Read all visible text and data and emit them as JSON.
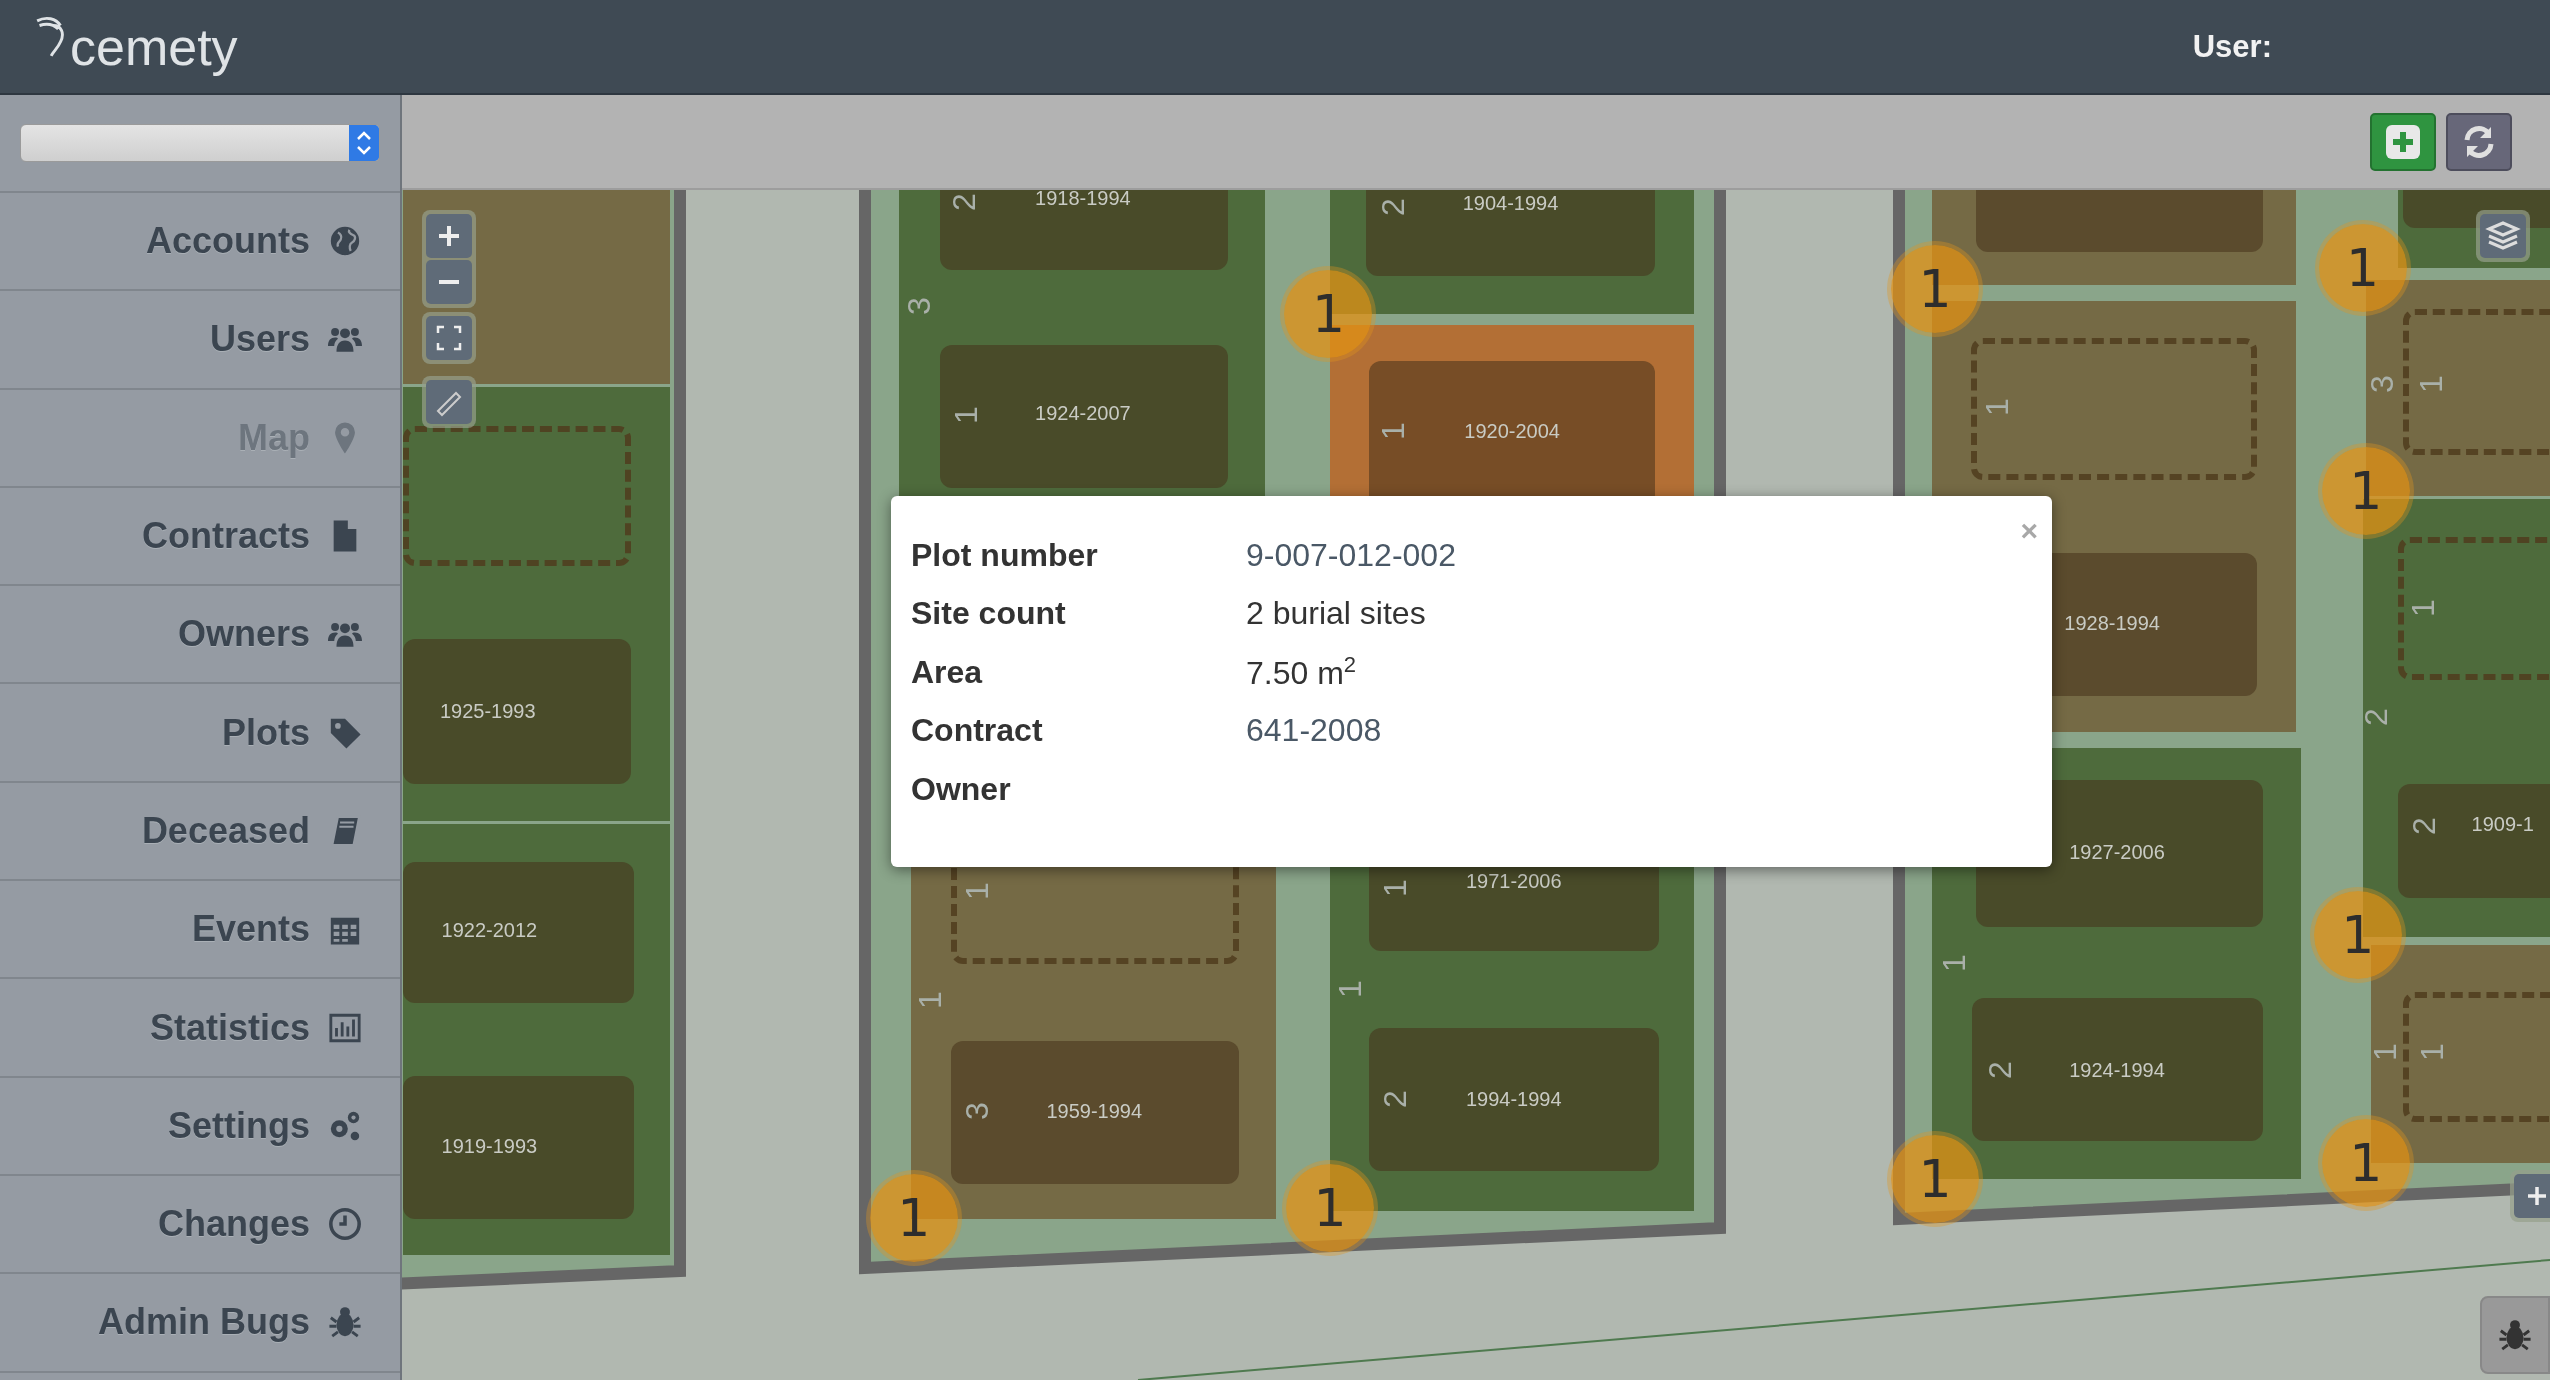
{
  "header": {
    "logo": "cemety",
    "user_label": "User:"
  },
  "sidebar": {
    "items": [
      {
        "label": "Accounts",
        "selected": false
      },
      {
        "label": "Users",
        "selected": false
      },
      {
        "label": "Map",
        "selected": true
      },
      {
        "label": "Contracts",
        "selected": false
      },
      {
        "label": "Owners",
        "selected": false
      },
      {
        "label": "Plots",
        "selected": false
      },
      {
        "label": "Deceased",
        "selected": false
      },
      {
        "label": "Events",
        "selected": false
      },
      {
        "label": "Statistics",
        "selected": false
      },
      {
        "label": "Settings",
        "selected": false
      },
      {
        "label": "Changes",
        "selected": false
      },
      {
        "label": "Admin Bugs",
        "selected": false
      }
    ]
  },
  "map": {
    "plots": [
      {
        "color": "#756a45"
      },
      {
        "color": "#4e6b3c"
      },
      {
        "color": "#4e6b3c"
      },
      {
        "color": "#4e6b3c"
      },
      {
        "color": "#756a45"
      },
      {
        "color": "#4e6b3c"
      },
      {
        "color": "#b36f35"
      },
      {
        "color": "#4e6b3c"
      },
      {
        "color": "#756a45"
      },
      {
        "color": "#756a45"
      },
      {
        "color": "#4e6b3c"
      },
      {
        "color": "#4e6b3c"
      },
      {
        "color": "#756a45"
      },
      {
        "color": "#4e6b3c"
      },
      {
        "color": "#756a45"
      }
    ],
    "graves": [
      {
        "kind": "empty"
      },
      {
        "kind": "occupied",
        "years": "1925-1993"
      },
      {
        "kind": "occupied",
        "years": "1922-2012"
      },
      {
        "kind": "occupied",
        "years": "1919-1993"
      },
      {
        "kind": "occupied",
        "years": "1918-1994"
      },
      {
        "kind": "occupied",
        "years": "1924-2007"
      },
      {
        "kind": "empty"
      },
      {
        "kind": "occupied",
        "years": "1959-1994"
      },
      {
        "kind": "occupied",
        "years": "1904-1994"
      },
      {
        "kind": "occupied",
        "years": "1920-2004"
      },
      {
        "kind": "occupied",
        "years": "1971-2006"
      },
      {
        "kind": "occupied",
        "years": "1994-1994"
      },
      {
        "kind": "occupied"
      },
      {
        "kind": "empty"
      },
      {
        "kind": "occupied",
        "years": "1928-1994"
      },
      {
        "kind": "occupied",
        "years": "1927-2006"
      },
      {
        "kind": "occupied",
        "years": "1924-1994"
      },
      {
        "kind": "occupied"
      },
      {
        "kind": "empty"
      },
      {
        "kind": "empty"
      },
      {
        "kind": "occupied",
        "years": "1909-1"
      },
      {
        "kind": "empty"
      }
    ],
    "row_labels": [
      "2",
      "3",
      "1",
      "1",
      "1",
      "3",
      "2",
      "1",
      "1",
      "1",
      "2",
      "1",
      "1",
      "2",
      "3",
      "1",
      "1",
      "2",
      "2",
      "1",
      "1"
    ],
    "clusters": [
      {
        "count": "1"
      },
      {
        "count": "1"
      },
      {
        "count": "1"
      },
      {
        "count": "1"
      },
      {
        "count": "1"
      },
      {
        "count": "1"
      },
      {
        "count": "1"
      },
      {
        "count": "1"
      },
      {
        "count": "1"
      }
    ],
    "popup": {
      "rows": [
        {
          "label": "Plot number",
          "value": "9-007-012-002",
          "kind": "link"
        },
        {
          "label": "Site count",
          "value": "2 burial sites",
          "kind": "text"
        },
        {
          "label": "Area",
          "value": "7.50 m$^{2}$",
          "kind": "text"
        },
        {
          "label": "Contract",
          "value": "641-2008",
          "kind": "link"
        },
        {
          "label": "Owner"
        }
      ],
      "close": "×"
    }
  }
}
